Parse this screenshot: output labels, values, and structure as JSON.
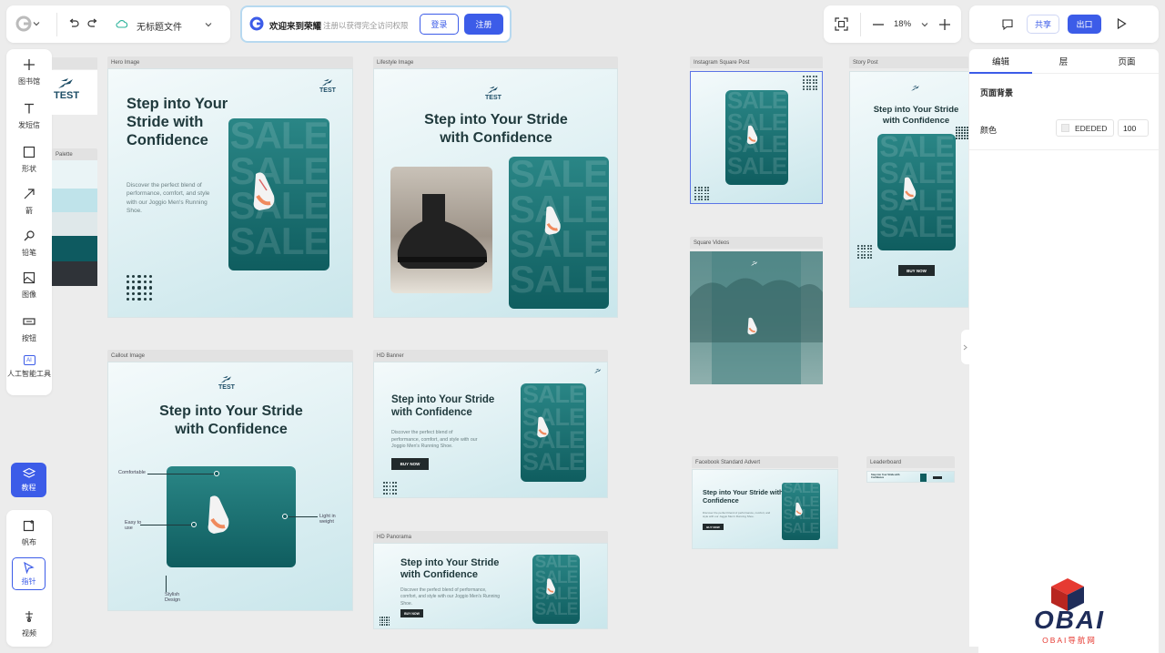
{
  "topbar": {
    "file_name": "无标题文件",
    "banner_text": "欢迎来到荣耀",
    "banner_sub": "注册以获得完全访问权限",
    "login_label": "登录",
    "register_label": "注册",
    "zoom": "18%",
    "share_label": "共享",
    "export_label": "出口"
  },
  "left_toolbar": {
    "items": [
      {
        "label": "图书馆"
      },
      {
        "label": "发短信"
      },
      {
        "label": "形状"
      },
      {
        "label": "箭"
      },
      {
        "label": "铅笔"
      },
      {
        "label": "图像"
      },
      {
        "label": "按钮"
      },
      {
        "label": "人工智能工具",
        "badge": "AI"
      }
    ]
  },
  "bottom_toolbar": {
    "tutorial_label": "教程",
    "canvas_label": "帆布",
    "pointer_label": "指针",
    "video_label": "视频"
  },
  "right_panel": {
    "tabs": [
      "编辑",
      "层",
      "页面"
    ],
    "section_title": "页面背景",
    "color_label": "颜色",
    "color_value": "EDEDED",
    "opacity_value": "100"
  },
  "canvas": {
    "logo_text": "TEST",
    "palette_label": "Palette",
    "palette_colors": [
      "#eaf4f6",
      "#bfe3ea",
      "#dfe8ea",
      "#0e5a60",
      "#2f3338"
    ],
    "frames": {
      "hero": {
        "label": "Hero Image",
        "headline": "Step into Your Stride with Confidence",
        "sub": "Discover the perfect blend of performance, comfort, and style with our Joggio Men's Running Shoe."
      },
      "lifestyle": {
        "label": "Lifestyle Image",
        "headline": "Step into Your Stride with Confidence"
      },
      "callout": {
        "label": "Callout Image",
        "headline": "Step into Your Stride with Confidence",
        "callout_1": "Comfortable",
        "callout_2": "Easy to use",
        "callout_3": "Light in weight",
        "callout_4": "Stylish Design"
      },
      "hd_banner": {
        "label": "HD Banner",
        "headline": "Step into Your Stride with Confidence",
        "sub": "Discover the perfect blend of performance, comfort, and style with our Joggio Men's Running Shoe.",
        "cta": "BUY NOW"
      },
      "hd_panorama": {
        "label": "HD Panorama",
        "headline": "Step into Your Stride with Confidence",
        "sub": "Discover the perfect blend of performance, comfort, and style with our Joggio Men's Running Shoe.",
        "cta": "BUY NOW"
      },
      "insta": {
        "label": "Instagram Square Post"
      },
      "square_videos": {
        "label": "Square Videos"
      },
      "story": {
        "label": "Story Post",
        "headline": "Step into Your Stride with Confidence",
        "cta": "BUY NOW"
      },
      "facebook": {
        "label": "Facebook Standard Advert",
        "headline": "Step into Your Stride with Confidence",
        "sub": "Discover the perfect blend of performance, comfort, and style with our Joggio Men's Running Shoe.",
        "cta": "BUY NOW"
      },
      "leaderboard": {
        "label": "Leaderboard",
        "headline": "Step into Your Stride with Confidence"
      }
    },
    "sale_word": "SALE"
  },
  "watermark": {
    "brand": "OBAI",
    "sub": "OBAI导航网"
  },
  "colors": {
    "accent": "#3c5ce8",
    "teal": "#0f5d5f"
  }
}
